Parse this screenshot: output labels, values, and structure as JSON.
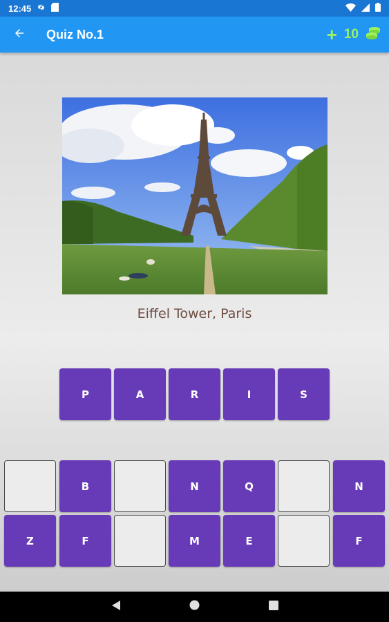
{
  "status_bar": {
    "time": "12:45",
    "icons": [
      "gear-icon",
      "sd-card-icon",
      "wifi-icon",
      "signal-icon",
      "battery-icon"
    ]
  },
  "app_bar": {
    "title": "Quiz No.1",
    "add_coins_label": "+",
    "coin_count": "10",
    "icons": [
      "back-arrow-icon",
      "coins-icon"
    ]
  },
  "quiz": {
    "image_subject": "Eiffel Tower, Paris",
    "caption": "Eiffel Tower, Paris"
  },
  "answer_tiles": [
    "P",
    "A",
    "R",
    "I",
    "S"
  ],
  "letter_pool": {
    "row1": [
      "",
      "B",
      "",
      "N",
      "Q",
      "",
      "N"
    ],
    "row2": [
      "Z",
      "F",
      "",
      "M",
      "E",
      "",
      "F"
    ]
  },
  "nav_bar": {
    "icons": [
      "back-triangle-icon",
      "home-circle-icon",
      "recents-square-icon"
    ]
  },
  "colors": {
    "status_bar": "#1976d2",
    "app_bar": "#2196f3",
    "coin_accent": "#9cf25f",
    "tile_fill": "#673ab7",
    "caption": "#6d4c41"
  }
}
